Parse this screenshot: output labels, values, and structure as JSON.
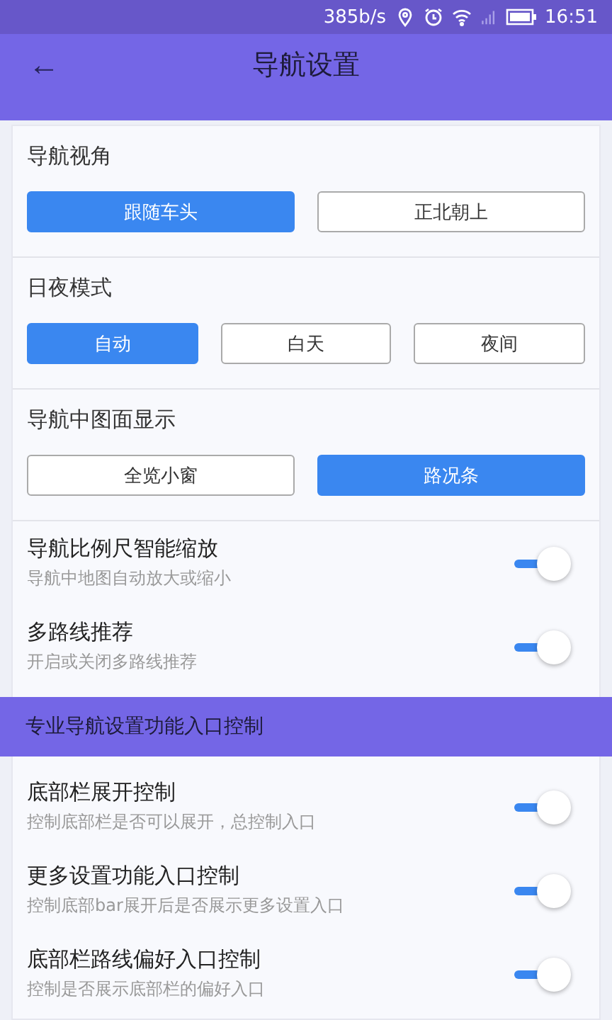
{
  "status_bar": {
    "speed": "385b/s",
    "time": "16:51"
  },
  "header": {
    "title": "导航设置",
    "back": "←"
  },
  "choice_groups": [
    {
      "title": "导航视角",
      "options": [
        {
          "label": "跟随车头",
          "selected": true
        },
        {
          "label": "正北朝上",
          "selected": false
        }
      ]
    },
    {
      "title": "日夜模式",
      "options": [
        {
          "label": "自动",
          "selected": true
        },
        {
          "label": "白天",
          "selected": false
        },
        {
          "label": "夜间",
          "selected": false
        }
      ]
    },
    {
      "title": "导航中图面显示",
      "options": [
        {
          "label": "全览小窗",
          "selected": false
        },
        {
          "label": "路况条",
          "selected": true
        }
      ]
    }
  ],
  "toggles": [
    {
      "title": "导航比例尺智能缩放",
      "subtitle": "导航中地图自动放大或缩小",
      "on": true
    },
    {
      "title": "多路线推荐",
      "subtitle": "开启或关闭多路线推荐",
      "on": true
    }
  ],
  "section": {
    "title": "专业导航设置功能入口控制"
  },
  "pro_toggles": [
    {
      "title": "底部栏展开控制",
      "subtitle": "控制底部栏是否可以展开，总控制入口",
      "on": true
    },
    {
      "title": "更多设置功能入口控制",
      "subtitle": "控制底部bar展开后是否展示更多设置入口",
      "on": true
    },
    {
      "title": "底部栏路线偏好入口控制",
      "subtitle": "控制是否展示底部栏的偏好入口",
      "on": true
    }
  ]
}
